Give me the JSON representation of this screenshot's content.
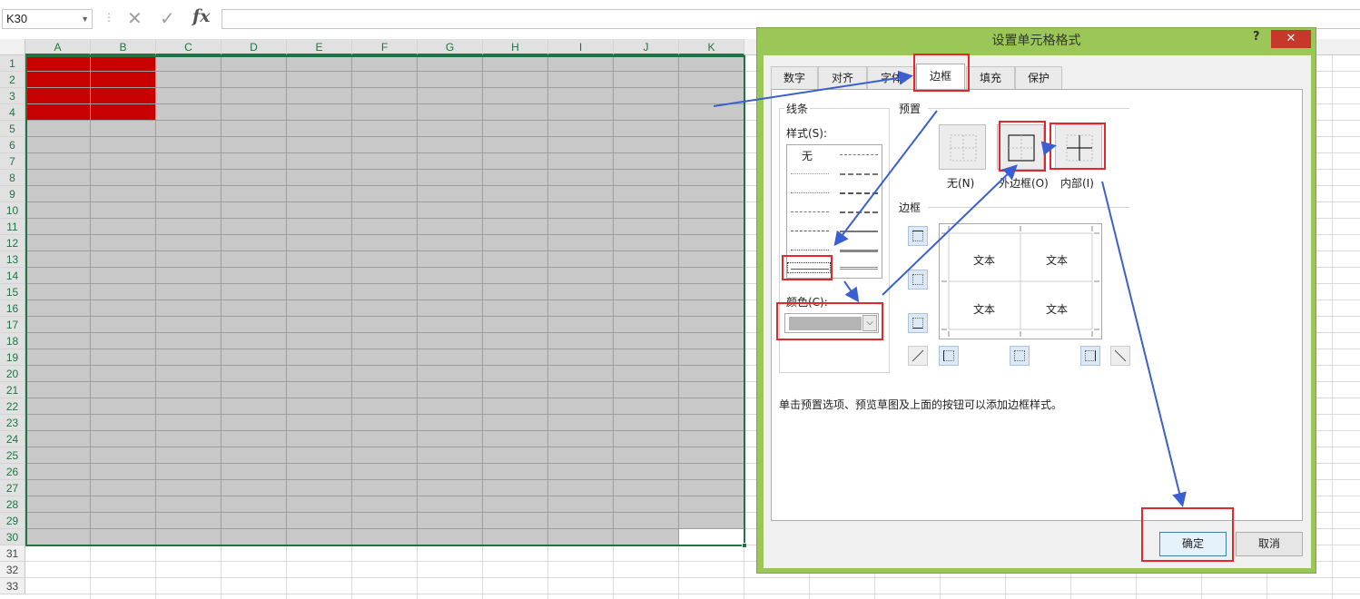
{
  "formula_bar": {
    "name_box": "K30",
    "fx_label": "fx",
    "cancel_glyph": "✕",
    "enter_glyph": "✓",
    "separator": "⋮"
  },
  "sheet": {
    "columns": [
      "A",
      "B",
      "C",
      "D",
      "E",
      "F",
      "G",
      "H",
      "I",
      "J",
      "K"
    ],
    "rows": [
      "1",
      "2",
      "3",
      "4",
      "5",
      "6",
      "7",
      "8",
      "9",
      "10",
      "11",
      "12",
      "13",
      "14",
      "15",
      "16",
      "17",
      "18",
      "19",
      "20",
      "21",
      "22",
      "23",
      "24",
      "25",
      "26",
      "27",
      "28",
      "29",
      "30",
      "31",
      "32",
      "33"
    ],
    "fill_colors": {
      "red": "#c80000",
      "gray": "#c8c8c8"
    },
    "selection_color": "#217346"
  },
  "dialog": {
    "title": "设置单元格格式",
    "help": "?",
    "close": "✕",
    "tabs": [
      "数字",
      "对齐",
      "字体",
      "边框",
      "填充",
      "保护"
    ],
    "active_tab": "边框",
    "lines": {
      "group_label": "线条",
      "style_label": "样式(S):",
      "none_style": "无",
      "color_label": "颜色(C):",
      "color_value": "#b4b4b4"
    },
    "presets": {
      "group_label": "预置",
      "none": "无(N)",
      "outline": "外边框(O)",
      "inside": "内部(I)"
    },
    "border": {
      "group_label": "边框",
      "preview_texts": [
        "文本",
        "文本",
        "文本",
        "文本"
      ]
    },
    "hint": "单击预置选项、预览草图及上面的按钮可以添加边框样式。",
    "ok": "确定",
    "cancel": "取消"
  },
  "annotation_color": "#e3272a",
  "arrow_color": "#3a5fd0"
}
